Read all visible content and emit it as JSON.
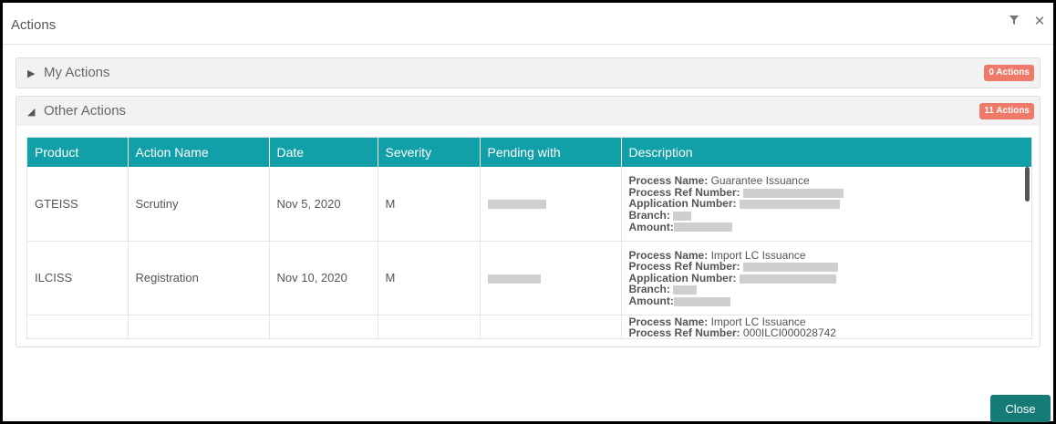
{
  "window": {
    "title": "Actions"
  },
  "header_icons": [
    "filter-icon",
    "close-icon"
  ],
  "my_actions": {
    "label": "My Actions",
    "badge": "0 Actions",
    "expanded": false
  },
  "other_actions": {
    "label": "Other Actions",
    "badge": "11 Actions",
    "expanded": true,
    "columns": [
      "Product",
      "Action Name",
      "Date",
      "Severity",
      "Pending with",
      "Description"
    ],
    "rows": [
      {
        "product": "GTEISS",
        "action": "Scrutiny",
        "date": "Nov 5, 2020",
        "severity": "M",
        "process_name_label": "Process Name:",
        "process_name": "Guarantee Issuance",
        "process_ref_label": "Process Ref Number:",
        "application_label": "Application Number:",
        "branch_label": "Branch:",
        "amount_label": "Amount:"
      },
      {
        "product": "ILCISS",
        "action": "Registration",
        "date": "Nov 10, 2020",
        "severity": "M",
        "process_name_label": "Process Name:",
        "process_name": "Import LC Issuance",
        "process_ref_label": "Process Ref Number:",
        "application_label": "Application Number:",
        "branch_label": "Branch:",
        "amount_label": "Amount:"
      },
      {
        "product": "",
        "action": "",
        "date": "",
        "severity": "",
        "process_name_label": "Process Name:",
        "process_name": "Import LC Issuance",
        "process_ref_label": "Process Ref Number:",
        "process_ref": "000ILCI000028742"
      }
    ]
  },
  "footer": {
    "close_label": "Close"
  },
  "colors": {
    "accent": "#12a0a8",
    "badge": "#f07a69",
    "button": "#157b77"
  }
}
